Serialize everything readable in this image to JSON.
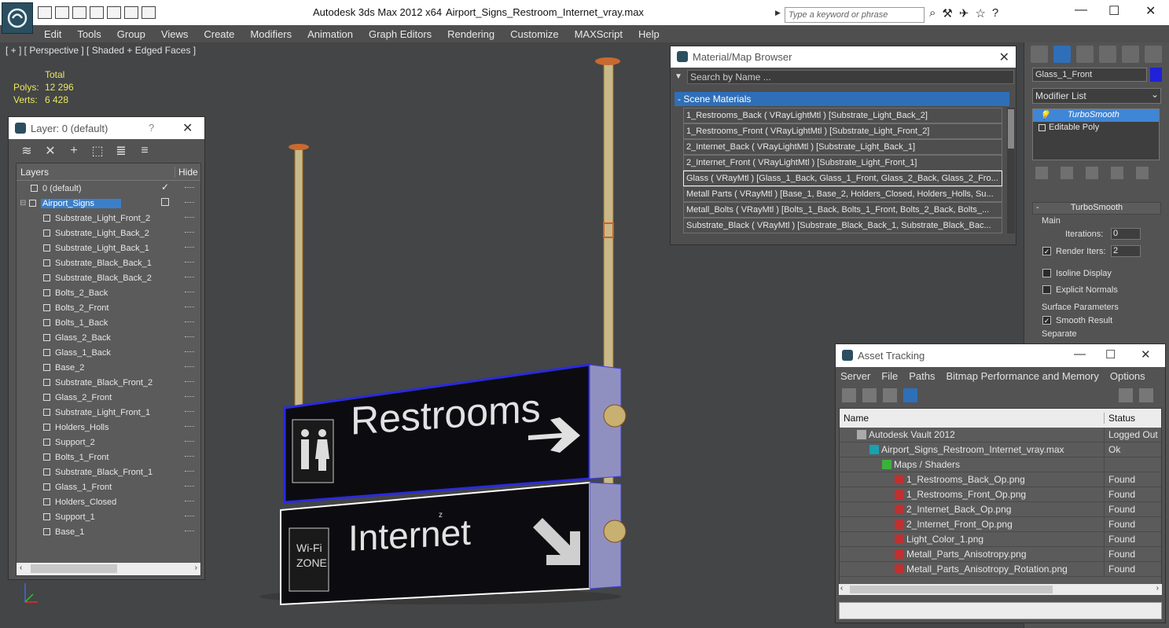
{
  "window": {
    "app_title": "Autodesk 3ds Max  2012 x64",
    "file_title": "Airport_Signs_Restroom_Internet_vray.max",
    "search_placeholder": "Type a keyword or phrase"
  },
  "menu": [
    "Edit",
    "Tools",
    "Group",
    "Views",
    "Create",
    "Modifiers",
    "Animation",
    "Graph Editors",
    "Rendering",
    "Customize",
    "MAXScript",
    "Help"
  ],
  "viewport": {
    "label": "[ + ] [ Perspective ] [ Shaded + Edged Faces ]",
    "stats": {
      "total_label": "Total",
      "polys_label": "Polys:",
      "polys_value": "12 296",
      "verts_label": "Verts:",
      "verts_value": "6 428"
    },
    "sign_top_text": "Restrooms",
    "sign_bottom_text": "Internet",
    "wifi_text_1": "Wi-Fi",
    "wifi_text_2": "ZONE",
    "axis_z": "z"
  },
  "layer_panel": {
    "title": "Layer: 0 (default)",
    "help": "?",
    "col_layers": "Layers",
    "col_hide": "Hide",
    "default_layer": "0 (default)",
    "selected_layer": "Airport_Signs",
    "objects": [
      "Substrate_Light_Front_2",
      "Substrate_Light_Back_2",
      "Substrate_Light_Back_1",
      "Substrate_Black_Back_1",
      "Substrate_Black_Back_2",
      "Bolts_2_Back",
      "Bolts_2_Front",
      "Bolts_1_Back",
      "Glass_2_Back",
      "Glass_1_Back",
      "Base_2",
      "Substrate_Black_Front_2",
      "Glass_2_Front",
      "Substrate_Light_Front_1",
      "Holders_Holls",
      "Support_2",
      "Bolts_1_Front",
      "Substrate_Black_Front_1",
      "Glass_1_Front",
      "Holders_Closed",
      "Support_1",
      "Base_1"
    ]
  },
  "material_browser": {
    "title": "Material/Map Browser",
    "search_placeholder": "Search by Name ...",
    "group": "- Scene Materials",
    "items": [
      "1_Restrooms_Back  ( VRayLightMtl ) [Substrate_Light_Back_2]",
      "1_Restrooms_Front  ( VRayLightMtl ) [Substrate_Light_Front_2]",
      "2_Internet_Back  ( VRayLightMtl ) [Substrate_Light_Back_1]",
      "2_Internet_Front  ( VRayLightMtl ) [Substrate_Light_Front_1]",
      "Glass  ( VRayMtl ) [Glass_1_Back, Glass_1_Front, Glass_2_Back, Glass_2_Fro...",
      "Metall Parts  ( VRayMtl ) [Base_1, Base_2, Holders_Closed, Holders_Holls, Su...",
      "Metall_Bolts  ( VRayMtl ) [Bolts_1_Back, Bolts_1_Front, Bolts_2_Back, Bolts_...",
      "Substrate_Black  ( VRayMtl ) [Substrate_Black_Back_1, Substrate_Black_Bac..."
    ],
    "selected_index": 4
  },
  "command_panel": {
    "object_name": "Glass_1_Front",
    "object_color": "#1f22d8",
    "modifier_list": "Modifier List",
    "stack": [
      "TurboSmooth",
      "Editable Poly"
    ],
    "rollout": "TurboSmooth",
    "main_label": "Main",
    "iterations_label": "Iterations:",
    "iterations_value": "0",
    "render_iters_label": "Render Iters:",
    "render_iters_value": "2",
    "isoline_label": "Isoline Display",
    "explicit_label": "Explicit Normals",
    "surface_label": "Surface Parameters",
    "smooth_label": "Smooth Result",
    "separate_label": "Separate"
  },
  "asset_tracking": {
    "title": "Asset Tracking",
    "menu": [
      "Server",
      "File",
      "Paths",
      "Bitmap Performance and Memory",
      "Options"
    ],
    "col_name": "Name",
    "col_status": "Status",
    "rows": [
      {
        "name": "Autodesk Vault 2012",
        "status": "Logged Out",
        "indent": 0,
        "icon": "vault-icon"
      },
      {
        "name": "Airport_Signs_Restroom_Internet_vray.max",
        "status": "Ok",
        "indent": 1,
        "icon": "max-file-icon"
      },
      {
        "name": "Maps / Shaders",
        "status": "",
        "indent": 2,
        "icon": "maps-icon"
      },
      {
        "name": "1_Restrooms_Back_Op.png",
        "status": "Found",
        "indent": 3,
        "icon": "png-icon"
      },
      {
        "name": "1_Restrooms_Front_Op.png",
        "status": "Found",
        "indent": 3,
        "icon": "png-icon"
      },
      {
        "name": "2_Internet_Back_Op.png",
        "status": "Found",
        "indent": 3,
        "icon": "png-icon"
      },
      {
        "name": "2_Internet_Front_Op.png",
        "status": "Found",
        "indent": 3,
        "icon": "png-icon"
      },
      {
        "name": "Light_Color_1.png",
        "status": "Found",
        "indent": 3,
        "icon": "png-icon"
      },
      {
        "name": "Metall_Parts_Anisotropy.png",
        "status": "Found",
        "indent": 3,
        "icon": "png-icon"
      },
      {
        "name": "Metall_Parts_Anisotropy_Rotation.png",
        "status": "Found",
        "indent": 3,
        "icon": "png-icon"
      }
    ]
  }
}
